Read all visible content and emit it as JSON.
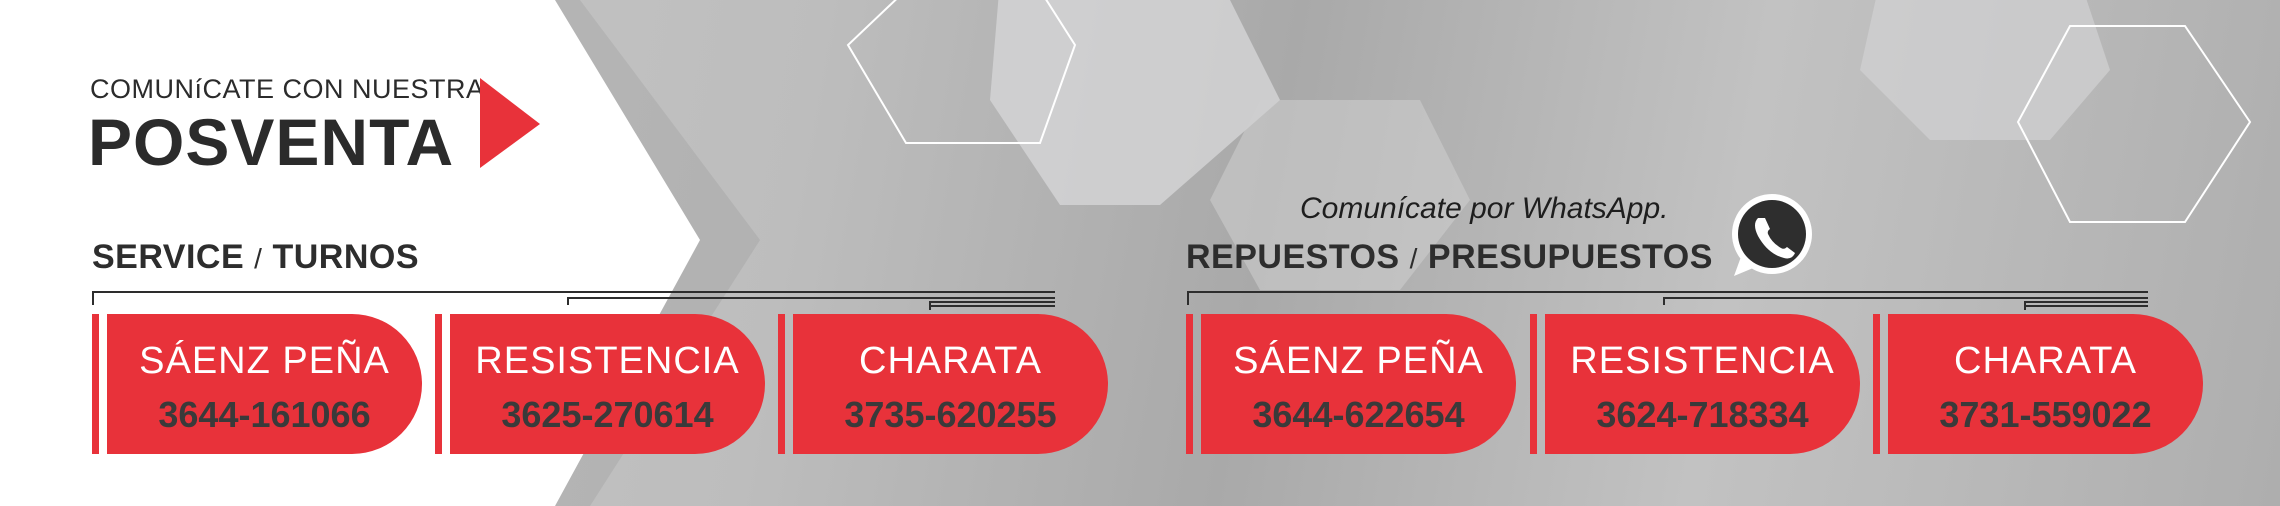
{
  "header": {
    "subtitle": "COMUNíCATE CON NUESTRA",
    "title": "POSVENTA"
  },
  "sections": {
    "service": {
      "left": "SERVICE",
      "slash": "/",
      "right": "TURNOS"
    },
    "repuestos": {
      "left": "REPUESTOS",
      "slash": "/",
      "right": "PRESUPUESTOS"
    }
  },
  "whatsapp": {
    "text": "Comunícate por WhatsApp."
  },
  "colors": {
    "accent": "#e8323a",
    "dark": "#2b2b2b",
    "background": "#bdbdbd"
  },
  "service_cards": [
    {
      "city": "SÁENZ PEÑA",
      "phone": "3644-161066"
    },
    {
      "city": "RESISTENCIA",
      "phone": "3625-270614"
    },
    {
      "city": "CHARATA",
      "phone": "3735-620255"
    }
  ],
  "repuestos_cards": [
    {
      "city": "SÁENZ PEÑA",
      "phone": "3644-622654"
    },
    {
      "city": "RESISTENCIA",
      "phone": "3624-718334"
    },
    {
      "city": "CHARATA",
      "phone": "3731-559022"
    }
  ],
  "icons": {
    "arrow": "play-triangle-icon",
    "whatsapp": "whatsapp-icon"
  }
}
